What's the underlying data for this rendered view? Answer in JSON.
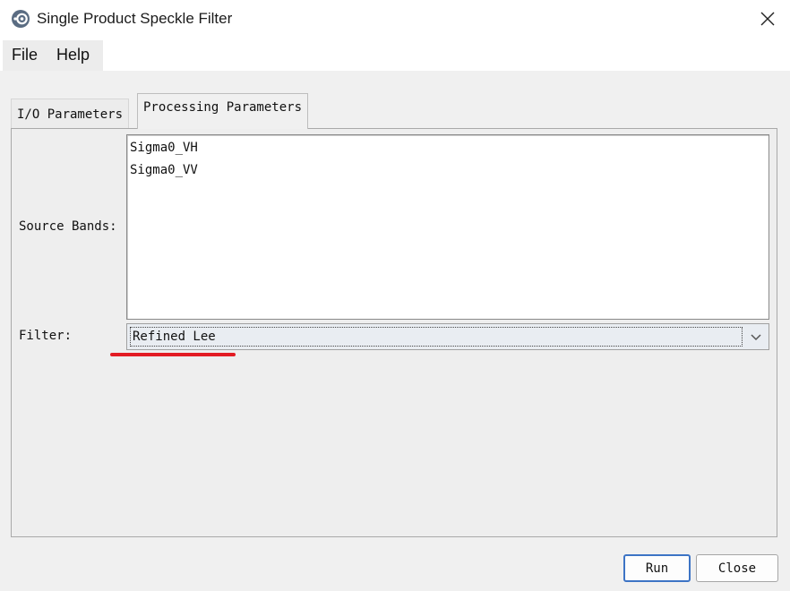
{
  "window": {
    "title": "Single Product Speckle Filter",
    "icon": "snap-app-icon",
    "close_icon": "close-icon"
  },
  "menu": {
    "items": [
      "File",
      "Help"
    ]
  },
  "tabs": [
    {
      "label": "I/O Parameters",
      "active": false
    },
    {
      "label": "Processing Parameters",
      "active": true
    }
  ],
  "form": {
    "source_bands_label": "Source Bands:",
    "source_bands": [
      "Sigma0_VH",
      "Sigma0_VV"
    ],
    "filter_label": "Filter:",
    "filter_value": "Refined Lee"
  },
  "buttons": {
    "run": "Run",
    "close": "Close"
  },
  "colors": {
    "highlight_underline": "#e31b23",
    "default_button_border": "#3d74c5"
  }
}
